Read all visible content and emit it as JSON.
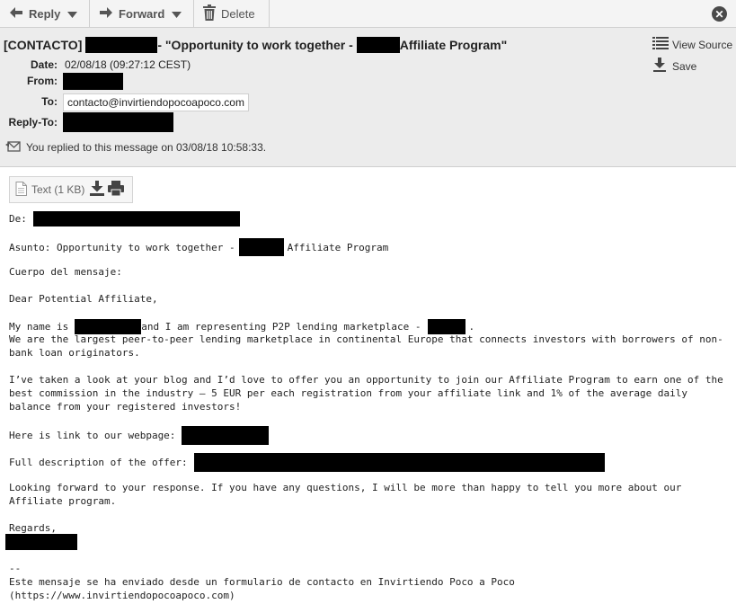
{
  "toolbar": {
    "reply": "Reply",
    "forward": "Forward",
    "delete": "Delete"
  },
  "header": {
    "subject_prefix": "[CONTACTO]",
    "subject_mid": "- \"Opportunity to work together -",
    "subject_end": "Affiliate Program\"",
    "date_label": "Date:",
    "date_value": "02/08/18 (09:27:12 CEST)",
    "from_label": "From:",
    "to_label": "To:",
    "to_value": "contacto@invirtiendopocoapoco.com",
    "replyto_label": "Reply-To:",
    "view_source": "View Source",
    "save": "Save",
    "replied_note": "You replied to this message on 03/08/18 10:58:33."
  },
  "attachment": {
    "label": "Text (1 KB)"
  },
  "body": {
    "de": "De:",
    "asunto_a": "Asunto: Opportunity to work together -",
    "asunto_b": "Affiliate Program",
    "cuerpo": "Cuerpo del mensaje:",
    "greeting": "Dear Potential Affiliate,",
    "p1_a": "My name is",
    "p1_b": "and I am representing P2P lending marketplace -",
    "p1_c": ".",
    "p1_l2": "We are the largest peer-to-peer lending marketplace in continental Europe that connects investors with borrowers of non-",
    "p1_l3": "bank loan originators.",
    "p2_l1": "I’ve taken a look at your blog and I’d love to offer you an opportunity to join our Affiliate Program to earn one of the",
    "p2_l2": "best commission in the industry – 5 EUR per each registration from your affiliate link and 1% of the average daily",
    "p2_l3": "balance from your registered investors!",
    "webpage": "Here is link to our webpage:",
    "offer": "Full description of the offer:",
    "p3_l1": "Looking forward to your response. If you have any questions, I will be more than happy to tell you more about our",
    "p3_l2": "Affiliate program.",
    "regards": "Regards,",
    "sig_sep": "--",
    "footer_l1": "Este mensaje se ha enviado desde un formulario de contacto en Invirtiendo Poco a Poco",
    "footer_l2": "(https://www.invirtiendopocoapoco.com)"
  }
}
